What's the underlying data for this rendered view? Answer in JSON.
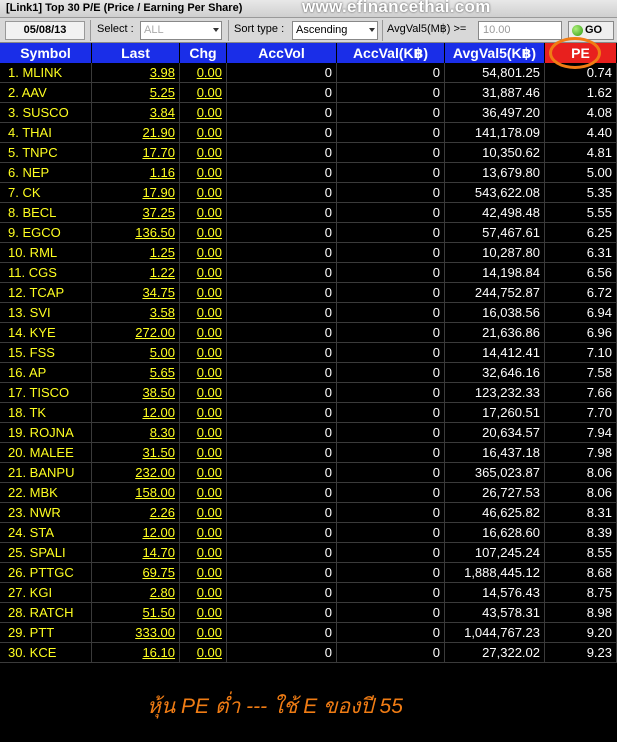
{
  "window": {
    "title": "[Link1] Top 30 P/E (Price / Earning Per Share)",
    "watermark": "www.efinancethai.com"
  },
  "toolbar": {
    "date": "05/08/13",
    "select_label": "Select :",
    "select_value": "ALL",
    "sort_label": "Sort type :",
    "sort_value": "Ascending",
    "avg_label": "AvgVal5(M฿) >=",
    "avg_value": "10.00",
    "go_label": "GO"
  },
  "table": {
    "headers": [
      "Symbol",
      "Last",
      "Chg",
      "AccVol",
      "AccVal(K฿)",
      "AvgVal5(K฿)",
      "PE"
    ],
    "rows": [
      [
        "1. MLINK",
        "3.98",
        "0.00",
        "0",
        "0",
        "54,801.25",
        "0.74"
      ],
      [
        "2. AAV",
        "5.25",
        "0.00",
        "0",
        "0",
        "31,887.46",
        "1.62"
      ],
      [
        "3. SUSCO",
        "3.84",
        "0.00",
        "0",
        "0",
        "36,497.20",
        "4.08"
      ],
      [
        "4. THAI",
        "21.90",
        "0.00",
        "0",
        "0",
        "141,178.09",
        "4.40"
      ],
      [
        "5. TNPC",
        "17.70",
        "0.00",
        "0",
        "0",
        "10,350.62",
        "4.81"
      ],
      [
        "6. NEP",
        "1.16",
        "0.00",
        "0",
        "0",
        "13,679.80",
        "5.00"
      ],
      [
        "7. CK",
        "17.90",
        "0.00",
        "0",
        "0",
        "543,622.08",
        "5.35"
      ],
      [
        "8. BECL",
        "37.25",
        "0.00",
        "0",
        "0",
        "42,498.48",
        "5.55"
      ],
      [
        "9. EGCO",
        "136.50",
        "0.00",
        "0",
        "0",
        "57,467.61",
        "6.25"
      ],
      [
        "10. RML",
        "1.25",
        "0.00",
        "0",
        "0",
        "10,287.80",
        "6.31"
      ],
      [
        "11. CGS",
        "1.22",
        "0.00",
        "0",
        "0",
        "14,198.84",
        "6.56"
      ],
      [
        "12. TCAP",
        "34.75",
        "0.00",
        "0",
        "0",
        "244,752.87",
        "6.72"
      ],
      [
        "13. SVI",
        "3.58",
        "0.00",
        "0",
        "0",
        "16,038.56",
        "6.94"
      ],
      [
        "14. KYE",
        "272.00",
        "0.00",
        "0",
        "0",
        "21,636.86",
        "6.96"
      ],
      [
        "15. FSS",
        "5.00",
        "0.00",
        "0",
        "0",
        "14,412.41",
        "7.10"
      ],
      [
        "16. AP",
        "5.65",
        "0.00",
        "0",
        "0",
        "32,646.16",
        "7.58"
      ],
      [
        "17. TISCO",
        "38.50",
        "0.00",
        "0",
        "0",
        "123,232.33",
        "7.66"
      ],
      [
        "18. TK",
        "12.00",
        "0.00",
        "0",
        "0",
        "17,260.51",
        "7.70"
      ],
      [
        "19. ROJNA",
        "8.30",
        "0.00",
        "0",
        "0",
        "20,634.57",
        "7.94"
      ],
      [
        "20. MALEE",
        "31.50",
        "0.00",
        "0",
        "0",
        "16,437.18",
        "7.98"
      ],
      [
        "21. BANPU",
        "232.00",
        "0.00",
        "0",
        "0",
        "365,023.87",
        "8.06"
      ],
      [
        "22. MBK",
        "158.00",
        "0.00",
        "0",
        "0",
        "26,727.53",
        "8.06"
      ],
      [
        "23. NWR",
        "2.26",
        "0.00",
        "0",
        "0",
        "46,625.82",
        "8.31"
      ],
      [
        "24. STA",
        "12.00",
        "0.00",
        "0",
        "0",
        "16,628.60",
        "8.39"
      ],
      [
        "25. SPALI",
        "14.70",
        "0.00",
        "0",
        "0",
        "107,245.24",
        "8.55"
      ],
      [
        "26. PTTGC",
        "69.75",
        "0.00",
        "0",
        "0",
        "1,888,445.12",
        "8.68"
      ],
      [
        "27. KGI",
        "2.80",
        "0.00",
        "0",
        "0",
        "14,576.43",
        "8.75"
      ],
      [
        "28. RATCH",
        "51.50",
        "0.00",
        "0",
        "0",
        "43,578.31",
        "8.98"
      ],
      [
        "29. PTT",
        "333.00",
        "0.00",
        "0",
        "0",
        "1,044,767.23",
        "9.20"
      ],
      [
        "30. KCE",
        "16.10",
        "0.00",
        "0",
        "0",
        "27,322.02",
        "9.23"
      ]
    ]
  },
  "annotation": "หุ้น PE ต่ำ --- ใช้ E ของปี 55",
  "colors": {
    "header_bg": "#1a2ee8",
    "pe_header_bg": "#e8201e",
    "symbol_text": "#ffff20",
    "highlight_ring": "#f07c14",
    "annotation_text": "#f07c14"
  }
}
